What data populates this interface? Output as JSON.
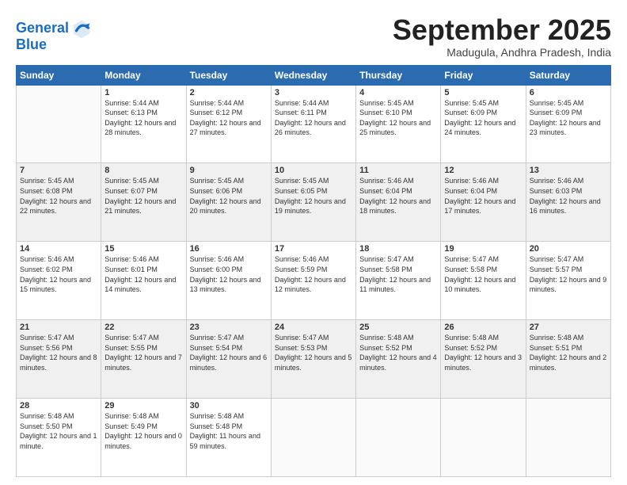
{
  "header": {
    "logo_line1": "General",
    "logo_line2": "Blue",
    "month_title": "September 2025",
    "location": "Madugula, Andhra Pradesh, India"
  },
  "weekdays": [
    "Sunday",
    "Monday",
    "Tuesday",
    "Wednesday",
    "Thursday",
    "Friday",
    "Saturday"
  ],
  "weeks": [
    [
      {
        "day": "",
        "sunrise": "",
        "sunset": "",
        "daylight": ""
      },
      {
        "day": "1",
        "sunrise": "Sunrise: 5:44 AM",
        "sunset": "Sunset: 6:13 PM",
        "daylight": "Daylight: 12 hours and 28 minutes."
      },
      {
        "day": "2",
        "sunrise": "Sunrise: 5:44 AM",
        "sunset": "Sunset: 6:12 PM",
        "daylight": "Daylight: 12 hours and 27 minutes."
      },
      {
        "day": "3",
        "sunrise": "Sunrise: 5:44 AM",
        "sunset": "Sunset: 6:11 PM",
        "daylight": "Daylight: 12 hours and 26 minutes."
      },
      {
        "day": "4",
        "sunrise": "Sunrise: 5:45 AM",
        "sunset": "Sunset: 6:10 PM",
        "daylight": "Daylight: 12 hours and 25 minutes."
      },
      {
        "day": "5",
        "sunrise": "Sunrise: 5:45 AM",
        "sunset": "Sunset: 6:09 PM",
        "daylight": "Daylight: 12 hours and 24 minutes."
      },
      {
        "day": "6",
        "sunrise": "Sunrise: 5:45 AM",
        "sunset": "Sunset: 6:09 PM",
        "daylight": "Daylight: 12 hours and 23 minutes."
      }
    ],
    [
      {
        "day": "7",
        "sunrise": "Sunrise: 5:45 AM",
        "sunset": "Sunset: 6:08 PM",
        "daylight": "Daylight: 12 hours and 22 minutes."
      },
      {
        "day": "8",
        "sunrise": "Sunrise: 5:45 AM",
        "sunset": "Sunset: 6:07 PM",
        "daylight": "Daylight: 12 hours and 21 minutes."
      },
      {
        "day": "9",
        "sunrise": "Sunrise: 5:45 AM",
        "sunset": "Sunset: 6:06 PM",
        "daylight": "Daylight: 12 hours and 20 minutes."
      },
      {
        "day": "10",
        "sunrise": "Sunrise: 5:45 AM",
        "sunset": "Sunset: 6:05 PM",
        "daylight": "Daylight: 12 hours and 19 minutes."
      },
      {
        "day": "11",
        "sunrise": "Sunrise: 5:46 AM",
        "sunset": "Sunset: 6:04 PM",
        "daylight": "Daylight: 12 hours and 18 minutes."
      },
      {
        "day": "12",
        "sunrise": "Sunrise: 5:46 AM",
        "sunset": "Sunset: 6:04 PM",
        "daylight": "Daylight: 12 hours and 17 minutes."
      },
      {
        "day": "13",
        "sunrise": "Sunrise: 5:46 AM",
        "sunset": "Sunset: 6:03 PM",
        "daylight": "Daylight: 12 hours and 16 minutes."
      }
    ],
    [
      {
        "day": "14",
        "sunrise": "Sunrise: 5:46 AM",
        "sunset": "Sunset: 6:02 PM",
        "daylight": "Daylight: 12 hours and 15 minutes."
      },
      {
        "day": "15",
        "sunrise": "Sunrise: 5:46 AM",
        "sunset": "Sunset: 6:01 PM",
        "daylight": "Daylight: 12 hours and 14 minutes."
      },
      {
        "day": "16",
        "sunrise": "Sunrise: 5:46 AM",
        "sunset": "Sunset: 6:00 PM",
        "daylight": "Daylight: 12 hours and 13 minutes."
      },
      {
        "day": "17",
        "sunrise": "Sunrise: 5:46 AM",
        "sunset": "Sunset: 5:59 PM",
        "daylight": "Daylight: 12 hours and 12 minutes."
      },
      {
        "day": "18",
        "sunrise": "Sunrise: 5:47 AM",
        "sunset": "Sunset: 5:58 PM",
        "daylight": "Daylight: 12 hours and 11 minutes."
      },
      {
        "day": "19",
        "sunrise": "Sunrise: 5:47 AM",
        "sunset": "Sunset: 5:58 PM",
        "daylight": "Daylight: 12 hours and 10 minutes."
      },
      {
        "day": "20",
        "sunrise": "Sunrise: 5:47 AM",
        "sunset": "Sunset: 5:57 PM",
        "daylight": "Daylight: 12 hours and 9 minutes."
      }
    ],
    [
      {
        "day": "21",
        "sunrise": "Sunrise: 5:47 AM",
        "sunset": "Sunset: 5:56 PM",
        "daylight": "Daylight: 12 hours and 8 minutes."
      },
      {
        "day": "22",
        "sunrise": "Sunrise: 5:47 AM",
        "sunset": "Sunset: 5:55 PM",
        "daylight": "Daylight: 12 hours and 7 minutes."
      },
      {
        "day": "23",
        "sunrise": "Sunrise: 5:47 AM",
        "sunset": "Sunset: 5:54 PM",
        "daylight": "Daylight: 12 hours and 6 minutes."
      },
      {
        "day": "24",
        "sunrise": "Sunrise: 5:47 AM",
        "sunset": "Sunset: 5:53 PM",
        "daylight": "Daylight: 12 hours and 5 minutes."
      },
      {
        "day": "25",
        "sunrise": "Sunrise: 5:48 AM",
        "sunset": "Sunset: 5:52 PM",
        "daylight": "Daylight: 12 hours and 4 minutes."
      },
      {
        "day": "26",
        "sunrise": "Sunrise: 5:48 AM",
        "sunset": "Sunset: 5:52 PM",
        "daylight": "Daylight: 12 hours and 3 minutes."
      },
      {
        "day": "27",
        "sunrise": "Sunrise: 5:48 AM",
        "sunset": "Sunset: 5:51 PM",
        "daylight": "Daylight: 12 hours and 2 minutes."
      }
    ],
    [
      {
        "day": "28",
        "sunrise": "Sunrise: 5:48 AM",
        "sunset": "Sunset: 5:50 PM",
        "daylight": "Daylight: 12 hours and 1 minute."
      },
      {
        "day": "29",
        "sunrise": "Sunrise: 5:48 AM",
        "sunset": "Sunset: 5:49 PM",
        "daylight": "Daylight: 12 hours and 0 minutes."
      },
      {
        "day": "30",
        "sunrise": "Sunrise: 5:48 AM",
        "sunset": "Sunset: 5:48 PM",
        "daylight": "Daylight: 11 hours and 59 minutes."
      },
      {
        "day": "",
        "sunrise": "",
        "sunset": "",
        "daylight": ""
      },
      {
        "day": "",
        "sunrise": "",
        "sunset": "",
        "daylight": ""
      },
      {
        "day": "",
        "sunrise": "",
        "sunset": "",
        "daylight": ""
      },
      {
        "day": "",
        "sunrise": "",
        "sunset": "",
        "daylight": ""
      }
    ]
  ]
}
